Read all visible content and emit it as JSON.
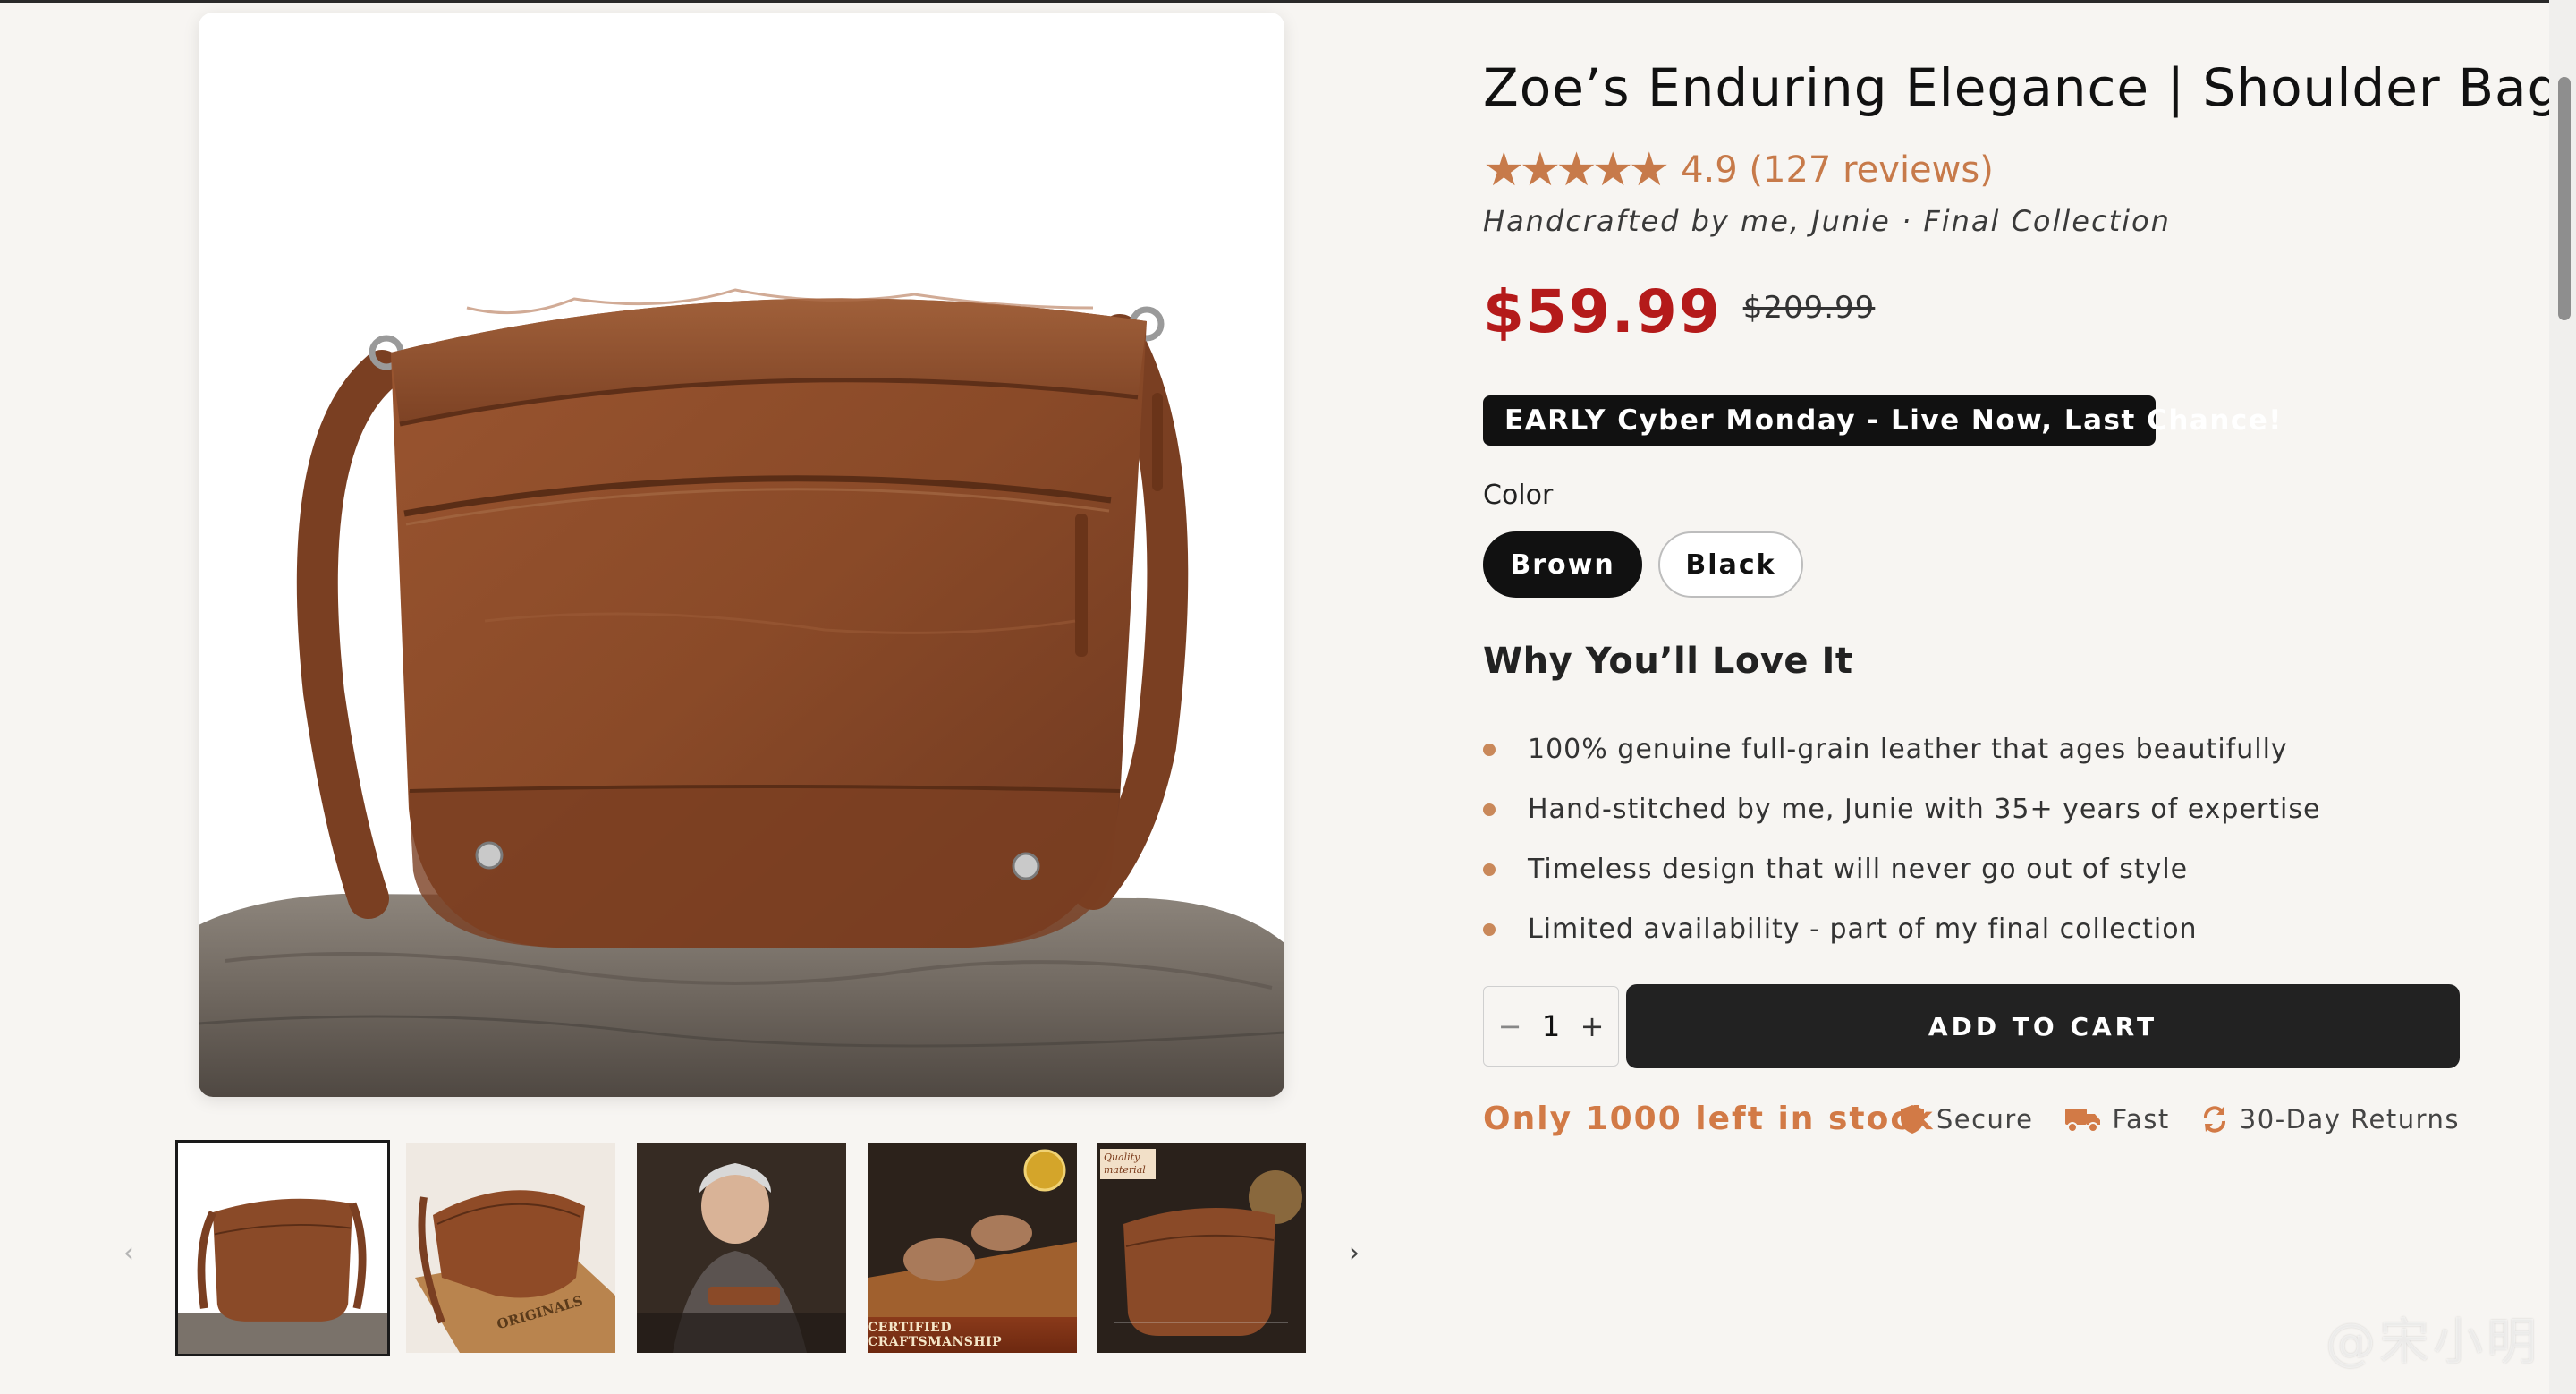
{
  "product": {
    "title": "Zoe’s Enduring Elegance | Shoulder Bag",
    "stars": "★★★★★",
    "rating_text": "4.9 (127 reviews)",
    "byline": "Handcrafted by me, Junie · Final Collection",
    "price": "$59.99",
    "compare_price": "$209.99",
    "promo_banner": "EARLY Cyber Monday - Live Now, Last Chance!",
    "color_label": "Color",
    "colors": [
      "Brown",
      "Black"
    ],
    "selected_color": "Brown",
    "why_heading": "Why You’ll Love It",
    "features": [
      "100% genuine full-grain leather that ages beautifully",
      "Hand-stitched by me, Junie with 35+ years of expertise",
      "Timeless design that will never go out of style",
      "Limited availability - part of my final collection"
    ],
    "quantity": "1",
    "qty_minus": "−",
    "qty_plus": "+",
    "add_to_cart": "ADD TO CART",
    "stock_text": "Only 1000 left in stock",
    "badges": [
      "Secure",
      "Fast",
      "30-Day Returns"
    ]
  },
  "gallery": {
    "prev_arrow": "‹",
    "next_arrow": "›",
    "thumb_caption_4": "CERTIFIED CRAFTSMANSHIP",
    "thumb_tag_5": "Quality material",
    "thumb_stamp_2": "ORIGINALS"
  },
  "colors": {
    "accent": "#c77a4a",
    "price_red": "#b41a1a",
    "button_dark": "#222222",
    "leather": "#8b4a2b"
  },
  "watermark": "@宋小明"
}
